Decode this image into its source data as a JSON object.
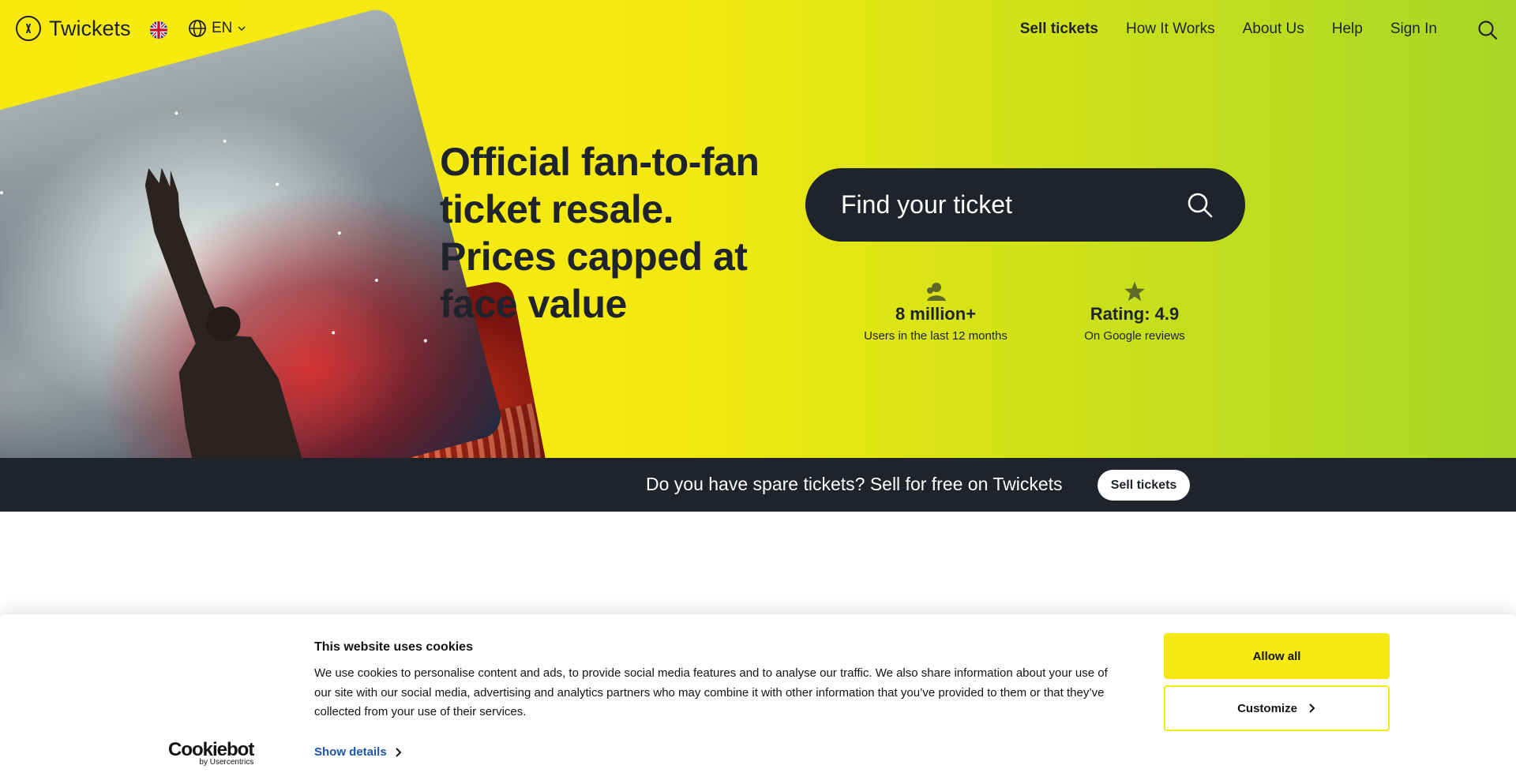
{
  "header": {
    "logo_text": "Twickets",
    "language": "EN",
    "nav": [
      "Sell tickets",
      "How It Works",
      "About Us",
      "Help",
      "Sign In"
    ]
  },
  "hero": {
    "headline": "Official fan-to-fan ticket resale. Prices capped at face value",
    "search_placeholder": "Find your ticket",
    "stats": [
      {
        "icon": "users-icon",
        "value": "8 million+",
        "label": "Users in the last 12 months"
      },
      {
        "icon": "star-icon",
        "value": "Rating: 4.9",
        "label": "On Google reviews"
      }
    ]
  },
  "promo": {
    "text": "Do you have spare tickets? Sell for free on Twickets",
    "button": "Sell tickets"
  },
  "cookie": {
    "brand": "Cookiebot",
    "brand_sub": "by Usercentrics",
    "title": "This website uses cookies",
    "body": "We use cookies to personalise content and ads, to provide social media features and to analyse our traffic. We also share information about your use of our site with our social media, advertising and analytics partners who may combine it with other information that you’ve provided to them or that they’ve collected from your use of their services.",
    "details": "Show details",
    "allow_all": "Allow all",
    "customize": "Customize"
  },
  "colors": {
    "brand_yellow": "#f6ea10",
    "dark": "#1f232b",
    "link_blue": "#1a56a8"
  }
}
